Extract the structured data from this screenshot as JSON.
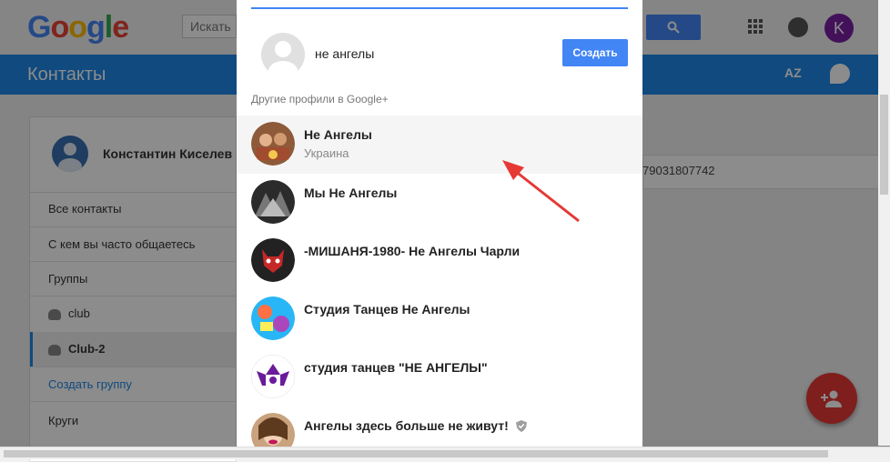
{
  "app": {
    "logo_letters": [
      "G",
      "o",
      "o",
      "g",
      "l",
      "e"
    ],
    "logo_colors": [
      "#4285f4",
      "#ea4335",
      "#fbbc05",
      "#4285f4",
      "#34a853",
      "#ea4335"
    ],
    "search_placeholder": "Искать",
    "avatar_letter": "K",
    "section_title": "Контакты",
    "az_label": "AZ"
  },
  "sidebar": {
    "profile_name": "Константин Киселев",
    "items": [
      {
        "label": "Все контакты"
      },
      {
        "label": "С кем вы часто общаетесь"
      },
      {
        "label": "Группы"
      },
      {
        "label": "club"
      },
      {
        "label": "Club-2"
      },
      {
        "label": "Создать группу"
      },
      {
        "label": "Круги"
      }
    ]
  },
  "main": {
    "phone": "79031807742"
  },
  "dialog": {
    "query": "не ангелы",
    "create_label": "Создать",
    "section_label": "Другие профили в Google+",
    "results": [
      {
        "name": "Не Ангелы",
        "subtitle": "Украина",
        "highlighted": true,
        "color": "#8d5a3a"
      },
      {
        "name": "Мы Не Ангелы",
        "subtitle": "",
        "highlighted": false,
        "color": "#555555"
      },
      {
        "name": "-МИШАНЯ-1980- Не Ангелы Чарли",
        "subtitle": "",
        "highlighted": false,
        "color": "#b71c1c"
      },
      {
        "name": "Студия Танцев Не Ангелы",
        "subtitle": "",
        "highlighted": false,
        "color": "#29b6f6"
      },
      {
        "name": "студия танцев \"НЕ АНГЕЛЫ\"",
        "subtitle": "",
        "highlighted": false,
        "color": "#6a1b9a"
      },
      {
        "name": "Ангелы здесь больше не живут!",
        "subtitle": "",
        "highlighted": false,
        "verified": true,
        "color": "#c9a27e"
      }
    ]
  },
  "colors": {
    "accent": "#4285f4",
    "bluebar": "#1e88e5",
    "fab": "#e53935",
    "arrow": "#e53935"
  }
}
